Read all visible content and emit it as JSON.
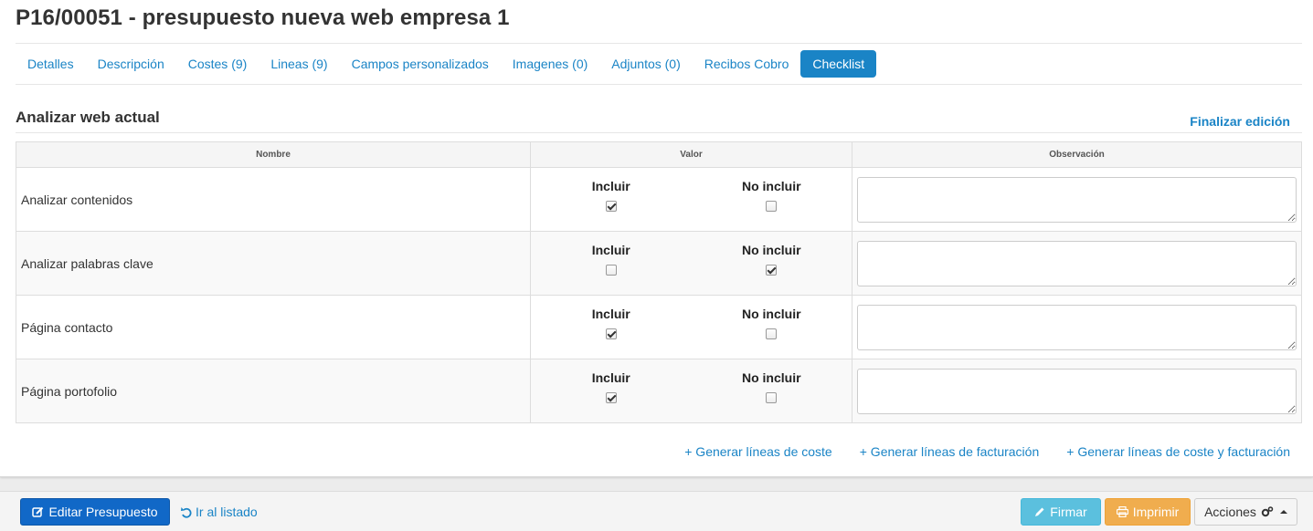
{
  "page": {
    "title": "P16/00051 - presupuesto nueva web empresa 1"
  },
  "tabs": [
    {
      "label": "Detalles",
      "active": false
    },
    {
      "label": "Descripción",
      "active": false
    },
    {
      "label": "Costes (9)",
      "active": false
    },
    {
      "label": "Lineas (9)",
      "active": false
    },
    {
      "label": "Campos personalizados",
      "active": false
    },
    {
      "label": "Imagenes (0)",
      "active": false
    },
    {
      "label": "Adjuntos (0)",
      "active": false
    },
    {
      "label": "Recibos Cobro",
      "active": false
    },
    {
      "label": "Checklist",
      "active": true
    }
  ],
  "section": {
    "title": "Analizar web actual",
    "finish_edit_label": "Finalizar edición"
  },
  "table": {
    "headers": {
      "name": "Nombre",
      "value": "Valor",
      "observation": "Observación"
    },
    "option_include": "Incluir",
    "option_exclude": "No incluir",
    "rows": [
      {
        "name": "Analizar contenidos",
        "include": true,
        "exclude": false,
        "observation": ""
      },
      {
        "name": "Analizar palabras clave",
        "include": false,
        "exclude": true,
        "observation": ""
      },
      {
        "name": "Página contacto",
        "include": true,
        "exclude": false,
        "observation": ""
      },
      {
        "name": "Página portofolio",
        "include": true,
        "exclude": false,
        "observation": ""
      }
    ]
  },
  "generate_links": [
    "+ Generar líneas de coste",
    "+ Generar líneas de facturación",
    "+ Generar líneas de coste y facturación"
  ],
  "footer": {
    "edit_label": "Editar Presupuesto",
    "list_label": "Ir al listado",
    "sign_label": "Firmar",
    "print_label": "Imprimir",
    "actions_label": "Acciones"
  },
  "colors": {
    "link": "#1a84c6",
    "primary": "#1168c7",
    "info": "#5bc0de",
    "warning": "#f0ad4e"
  },
  "icons": {
    "edit": "pencil-square-icon",
    "list": "undo-icon",
    "sign": "pencil-icon",
    "print": "print-icon",
    "actions": "cogs-icon"
  }
}
